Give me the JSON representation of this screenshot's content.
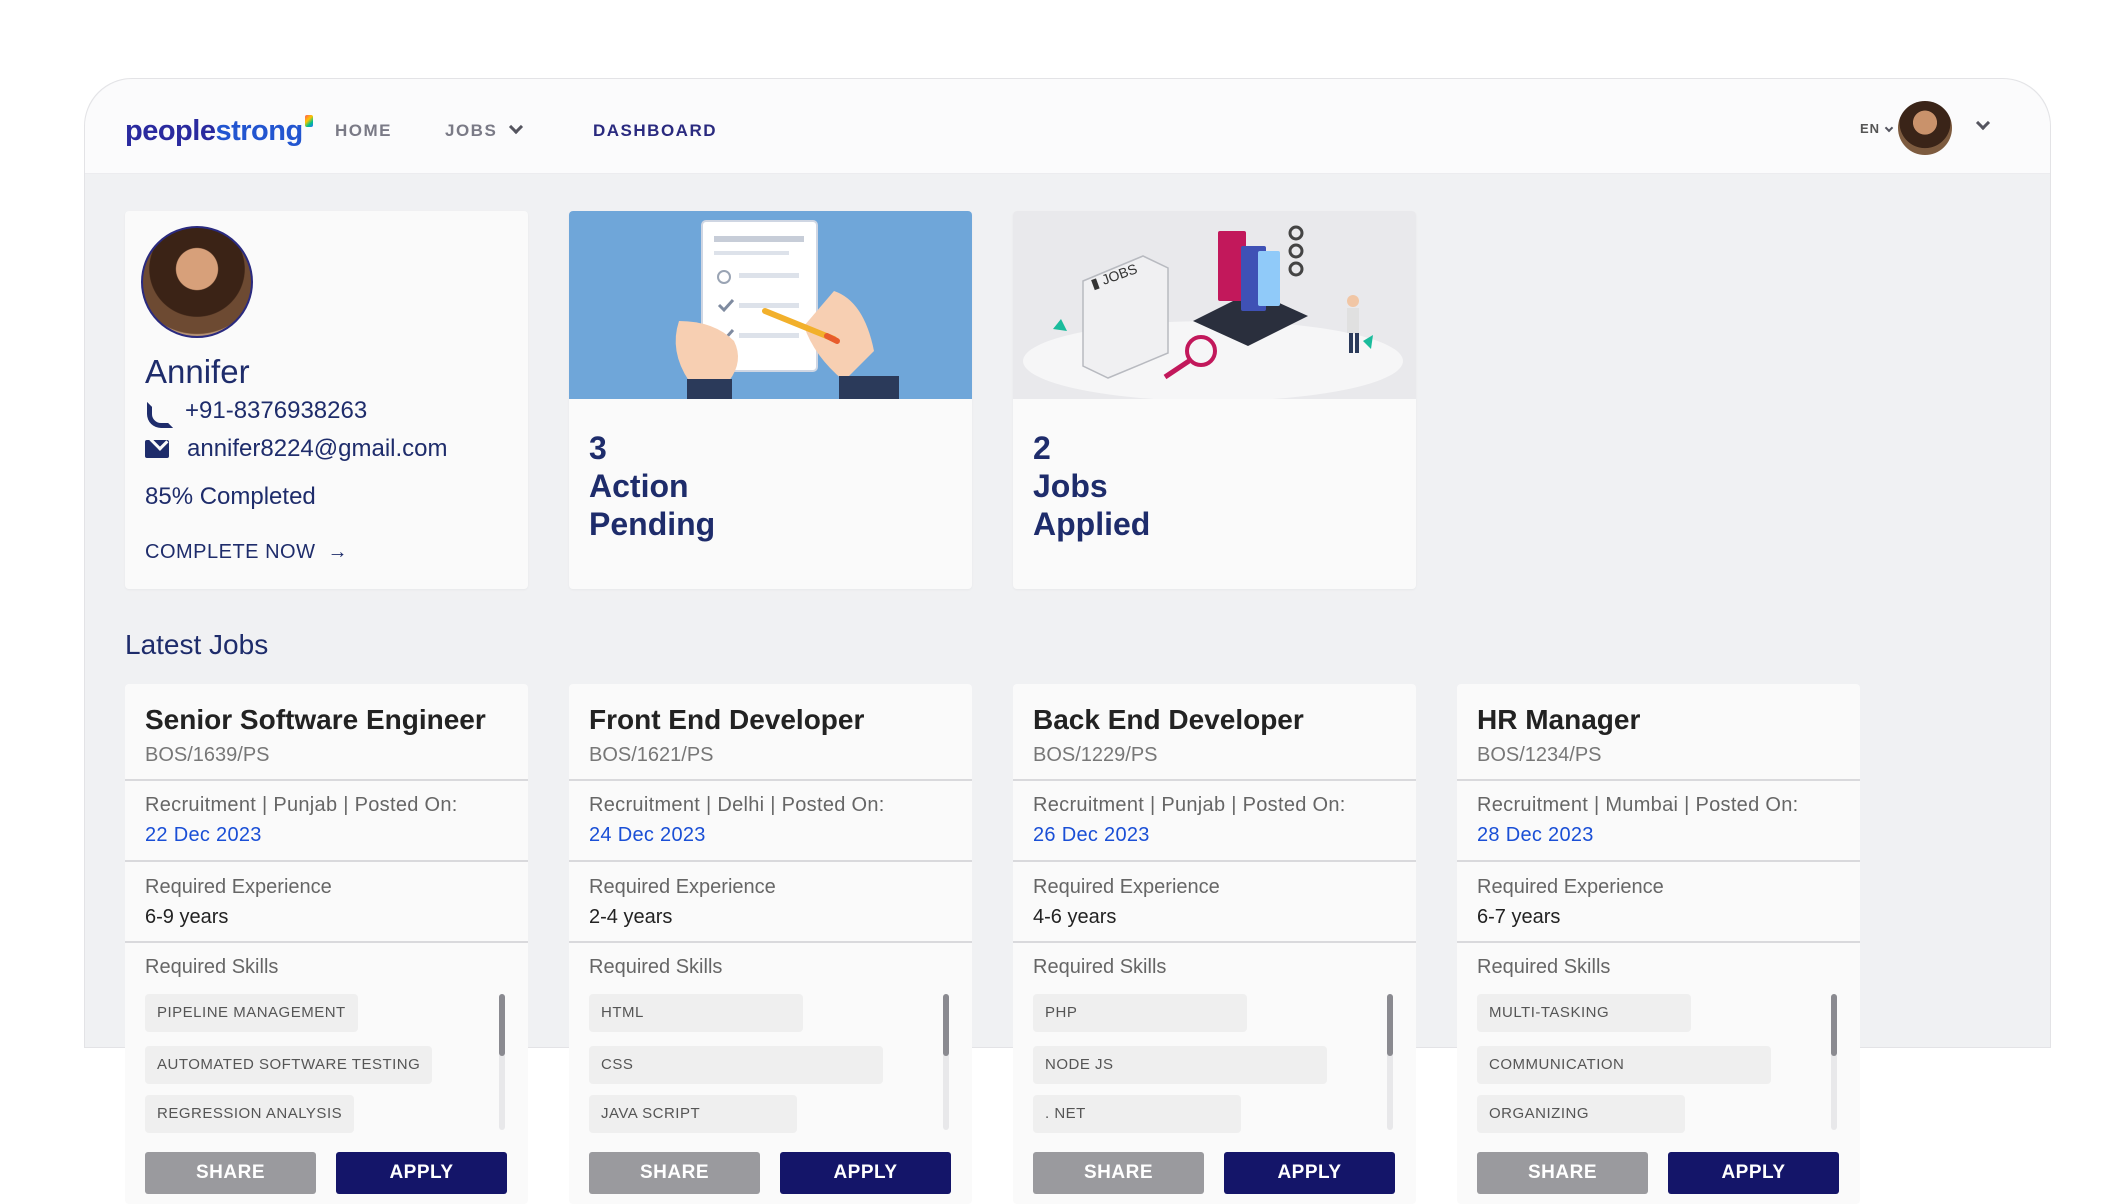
{
  "nav": {
    "logo_part1": "people",
    "logo_part2": "strong",
    "home": "HOME",
    "jobs": "JOBS",
    "dashboard": "DASHBOARD",
    "lang": "EN"
  },
  "profile": {
    "name": "Annifer",
    "phone": "+91-8376938263",
    "email": "annifer8224@gmail.com",
    "progress": "85% Completed",
    "progress_value": 0.85,
    "cta": "COMPLETE NOW"
  },
  "stats": [
    {
      "count": "3",
      "line1": "Action",
      "line2": "Pending"
    },
    {
      "count": "2",
      "line1": "Jobs",
      "line2": "Applied"
    }
  ],
  "latest_jobs_title": "Latest Jobs",
  "jobs": [
    {
      "title": "Senior Software Engineer",
      "code": "BOS/1639/PS",
      "meta": "Recruitment | Punjab | Posted On:",
      "date": "22 Dec 2023",
      "exp_label": "Required Experience",
      "exp": "6-9 years",
      "skills_label": "Required Skills",
      "skills": [
        "PIPELINE MANAGEMENT",
        "AUTOMATED SOFTWARE TESTING",
        "REGRESSION ANALYSIS"
      ],
      "share": "SHARE",
      "apply": "APPLY"
    },
    {
      "title": "Front End Developer",
      "code": "BOS/1621/PS",
      "meta": "Recruitment | Delhi | Posted On:",
      "date": "24 Dec 2023",
      "exp_label": "Required Experience",
      "exp": "2-4 years",
      "skills_label": "Required Skills",
      "skills": [
        "HTML",
        "CSS",
        "JAVA SCRIPT"
      ],
      "share": "SHARE",
      "apply": "APPLY"
    },
    {
      "title": "Back End Developer",
      "code": "BOS/1229/PS",
      "meta": "Recruitment | Punjab | Posted On:",
      "date": "26 Dec 2023",
      "exp_label": "Required Experience",
      "exp": "4-6 years",
      "skills_label": "Required Skills",
      "skills": [
        "PHP",
        "NODE JS",
        ". NET"
      ],
      "share": "SHARE",
      "apply": "APPLY"
    },
    {
      "title": "HR Manager",
      "code": "BOS/1234/PS",
      "meta": "Recruitment | Mumbai | Posted On:",
      "date": "28 Dec 2023",
      "exp_label": "Required Experience",
      "exp": "6-7 years",
      "skills_label": "Required Skills",
      "skills": [
        "MULTI-TASKING",
        "COMMUNICATION",
        "ORGANIZING"
      ],
      "share": "SHARE",
      "apply": "APPLY"
    }
  ],
  "icons": {
    "phone": "phone-icon",
    "mail": "mail-icon",
    "arrow": "arrow-right-icon",
    "chevron": "chevron-down-icon"
  },
  "colors": {
    "brand_dark": "#141569",
    "text_primary": "#1e2c6b",
    "date_blue": "#1a4fd6",
    "share_gray": "#9a9a9e",
    "hero1_bg": "#6fa6d9"
  }
}
